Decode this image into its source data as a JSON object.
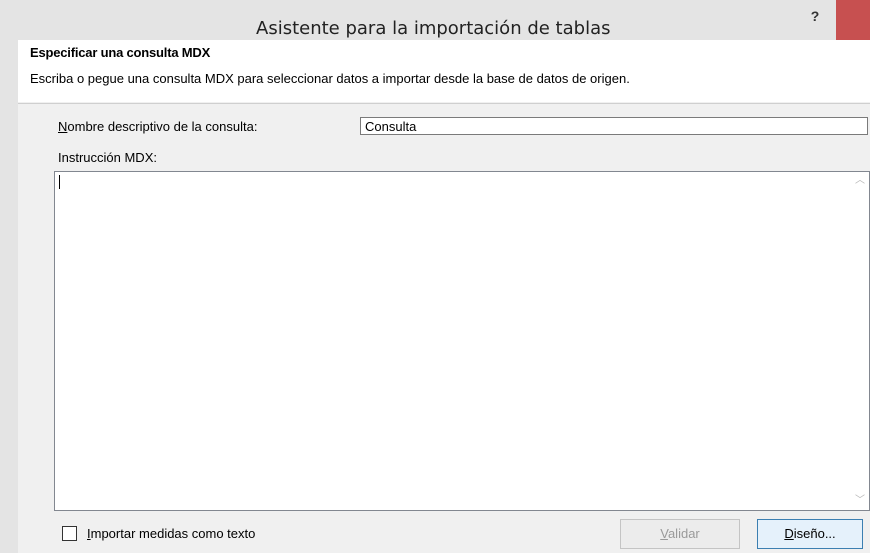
{
  "window": {
    "title": "Asistente para la importación de tablas",
    "help_label": "?"
  },
  "header": {
    "title": "Especificar una consulta MDX",
    "description": "Escriba o pegue una consulta MDX para seleccionar datos a importar desde la base de datos de origen."
  },
  "query_name": {
    "label_first": "N",
    "label_rest": "ombre descriptivo de la consulta:",
    "value": "Consulta"
  },
  "mdx": {
    "label": "Instrucción MDX:",
    "value": ""
  },
  "checkbox": {
    "label_first": "I",
    "label_rest": "mportar medidas como texto",
    "checked": false
  },
  "buttons": {
    "validate_first": "V",
    "validate_rest": "alidar",
    "design_first": "D",
    "design_rest": "iseño..."
  }
}
